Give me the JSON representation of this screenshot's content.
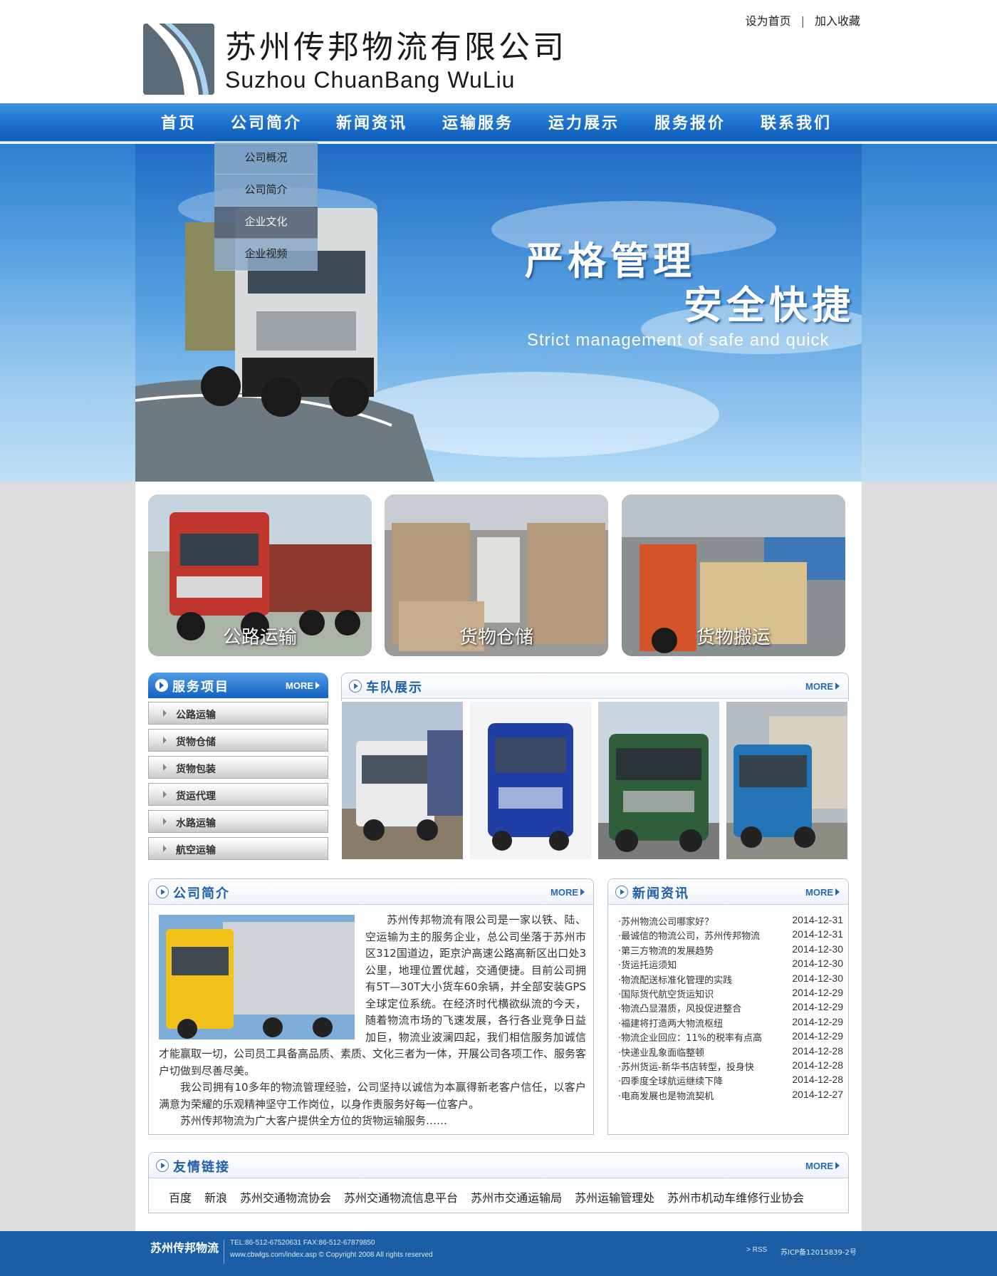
{
  "header": {
    "company_cn": "苏州传邦物流有限公司",
    "company_en": "Suzhou ChuanBang WuLiu",
    "top_links": [
      "设为首页",
      "加入收藏"
    ]
  },
  "nav": {
    "items": [
      "首页",
      "公司简介",
      "新闻资讯",
      "运输服务",
      "运力展示",
      "服务报价",
      "联系我们"
    ]
  },
  "dropdown": {
    "items": [
      "公司概况",
      "公司简介",
      "企业文化",
      "企业视频"
    ],
    "active": "企业文化"
  },
  "banner": {
    "slogan_line1": "严格管理",
    "slogan_line2": "安全快捷",
    "slogan_en": "Strict management of safe and quick"
  },
  "service_cards": [
    "公路运输",
    "货物仓储",
    "货物搬运"
  ],
  "services_panel": {
    "title": "服务项目",
    "more": "MORE",
    "items": [
      "公路运输",
      "货物仓储",
      "货物包装",
      "货运代理",
      "水路运输",
      "航空运输"
    ]
  },
  "fleet_panel": {
    "title": "车队展示",
    "more": "MORE"
  },
  "intro_panel": {
    "title": "公司简介",
    "more": "MORE",
    "paragraphs": [
      "苏州传邦物流有限公司是一家以铁、陆、空运输为主的服务企业，总公司坐落于苏州市区312国道边，距京沪高速公路高新区出口处3公里，地理位置优越，交通便捷。目前公司拥有5T—30T大小货车60余辆，并全部安装GPS全球定位系统。在经济时代横欲纵流的今天，随着物流市场的飞速发展，各行各业竞争日益加巨，物流业波澜四起，我们相信服务加诚信才能赢取一切，公司员工具备高品质、素质、文化三者为一体，开展公司各项工作、服务客户切做到尽善尽美。",
      "我公司拥有10多年的物流管理经验，公司坚持以诚信为本赢得新老客户信任，以客户满意为荣耀的乐观精神坚守工作岗位，以身作责服务好每一位客户。",
      "苏州传邦物流为广大客户提供全方位的货物运输服务……"
    ]
  },
  "news_panel": {
    "title": "新闻资讯",
    "more": "MORE",
    "items": [
      {
        "title": "·苏州物流公司哪家好？",
        "date": "2014-12-31"
      },
      {
        "title": "·最诚信的物流公司，苏州传邦物流",
        "date": "2014-12-31"
      },
      {
        "title": "·第三方物流的发展趋势",
        "date": "2014-12-30"
      },
      {
        "title": "·货运托运须知",
        "date": "2014-12-30"
      },
      {
        "title": "·物流配送标准化管理的实践",
        "date": "2014-12-30"
      },
      {
        "title": "·国际货代航空货运知识",
        "date": "2014-12-29"
      },
      {
        "title": "·物流凸显潜质，风投促进整合",
        "date": "2014-12-29"
      },
      {
        "title": "·福建将打造两大物流枢纽",
        "date": "2014-12-29"
      },
      {
        "title": "·物流企业回应：11%的税率有点高",
        "date": "2014-12-29"
      },
      {
        "title": "·快递业乱象面临整顿",
        "date": "2014-12-28"
      },
      {
        "title": "·苏州货运-新华书店转型，投身快",
        "date": "2014-12-28"
      },
      {
        "title": "·四季度全球航运继续下降",
        "date": "2014-12-28"
      },
      {
        "title": "·电商发展也是物流契机",
        "date": "2014-12-27"
      }
    ]
  },
  "links_panel": {
    "title": "友情链接",
    "more": "MORE",
    "items": [
      "百度",
      "新浪",
      "苏州交通物流协会",
      "苏州交通物流信息平台",
      "苏州市交通运输局",
      "苏州运输管理处",
      "苏州市机动车维修行业协会"
    ]
  },
  "footer": {
    "brand": "苏州传邦物流",
    "contact": "TEL:86-512-67520631    FAX:86-512-67879850",
    "copyright": "www.cbwlgs.com/index.asp © Copyright 2008 All rights reserved",
    "rss": "> RSS",
    "icp": "苏ICP备12015839-2号"
  },
  "colors": {
    "nav_blue": "#1f75d1",
    "footer_blue": "#1b5ea5",
    "panel_title": "#1e5fa8",
    "page_bg": "#dcdcdc"
  }
}
